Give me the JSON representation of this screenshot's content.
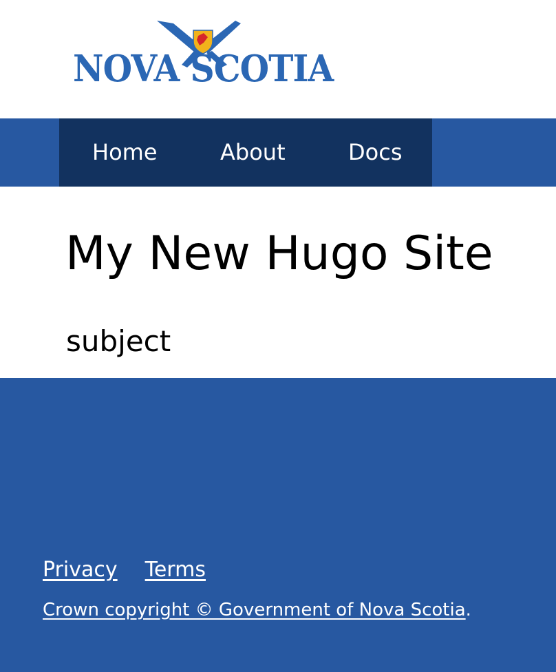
{
  "brand": {
    "logo_text": "NOVA SCOTIA",
    "primary_color": "#2b67b4",
    "accent_color": "#f2b21c"
  },
  "nav": {
    "items": [
      {
        "label": "Home"
      },
      {
        "label": "About"
      },
      {
        "label": "Docs"
      }
    ]
  },
  "main": {
    "title": "My New Hugo Site",
    "subject": "subject"
  },
  "footer": {
    "links": [
      {
        "label": "Privacy"
      },
      {
        "label": "Terms"
      }
    ],
    "copyright_link": "Crown copyright © Government of Nova Scotia",
    "copyright_suffix": "."
  },
  "colors": {
    "nav_bar": "#2758a1",
    "nav_inner": "#12325f",
    "footer": "#2758a1",
    "text_light": "#ffffff"
  }
}
